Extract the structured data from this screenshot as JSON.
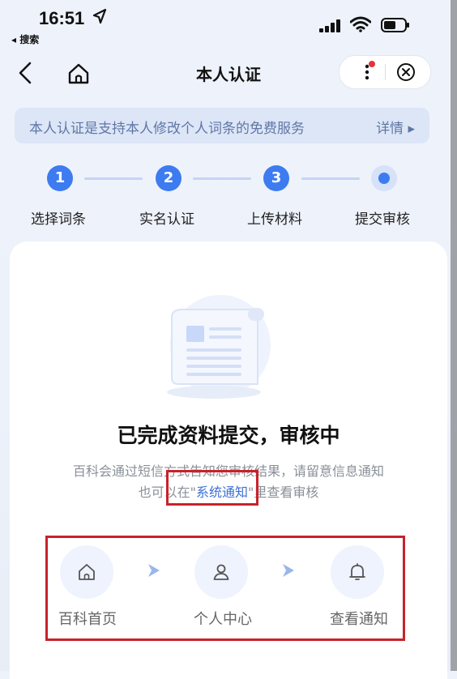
{
  "status": {
    "time": "16:51",
    "back_app": "◂ 搜索"
  },
  "nav": {
    "title": "本人认证"
  },
  "banner": {
    "text": "本人认证是支持本人修改个人词条的免费服务",
    "link": "详情 ▸"
  },
  "steps": [
    {
      "number": "1",
      "label": "选择词条"
    },
    {
      "number": "2",
      "label": "实名认证"
    },
    {
      "number": "3",
      "label": "上传材料"
    },
    {
      "number": "",
      "label": "提交审核"
    }
  ],
  "result": {
    "title": "已完成资料提交，审核中",
    "desc_line1": "百科会通过短信方式告知您审核结果，请留意信息通知",
    "desc_line2_prefix": "也可以在\"",
    "desc_line2_link": "系统通知",
    "desc_line2_suffix": "\"里查看审核"
  },
  "shortcuts": [
    {
      "label": "百科首页",
      "icon": "home-icon"
    },
    {
      "label": "个人中心",
      "icon": "user-icon"
    },
    {
      "label": "查看通知",
      "icon": "bell-icon"
    }
  ],
  "colors": {
    "accent": "#3d7bf0",
    "banner_bg": "#dde6f7",
    "banner_text": "#5f77a6",
    "highlight": "#c8222a"
  }
}
